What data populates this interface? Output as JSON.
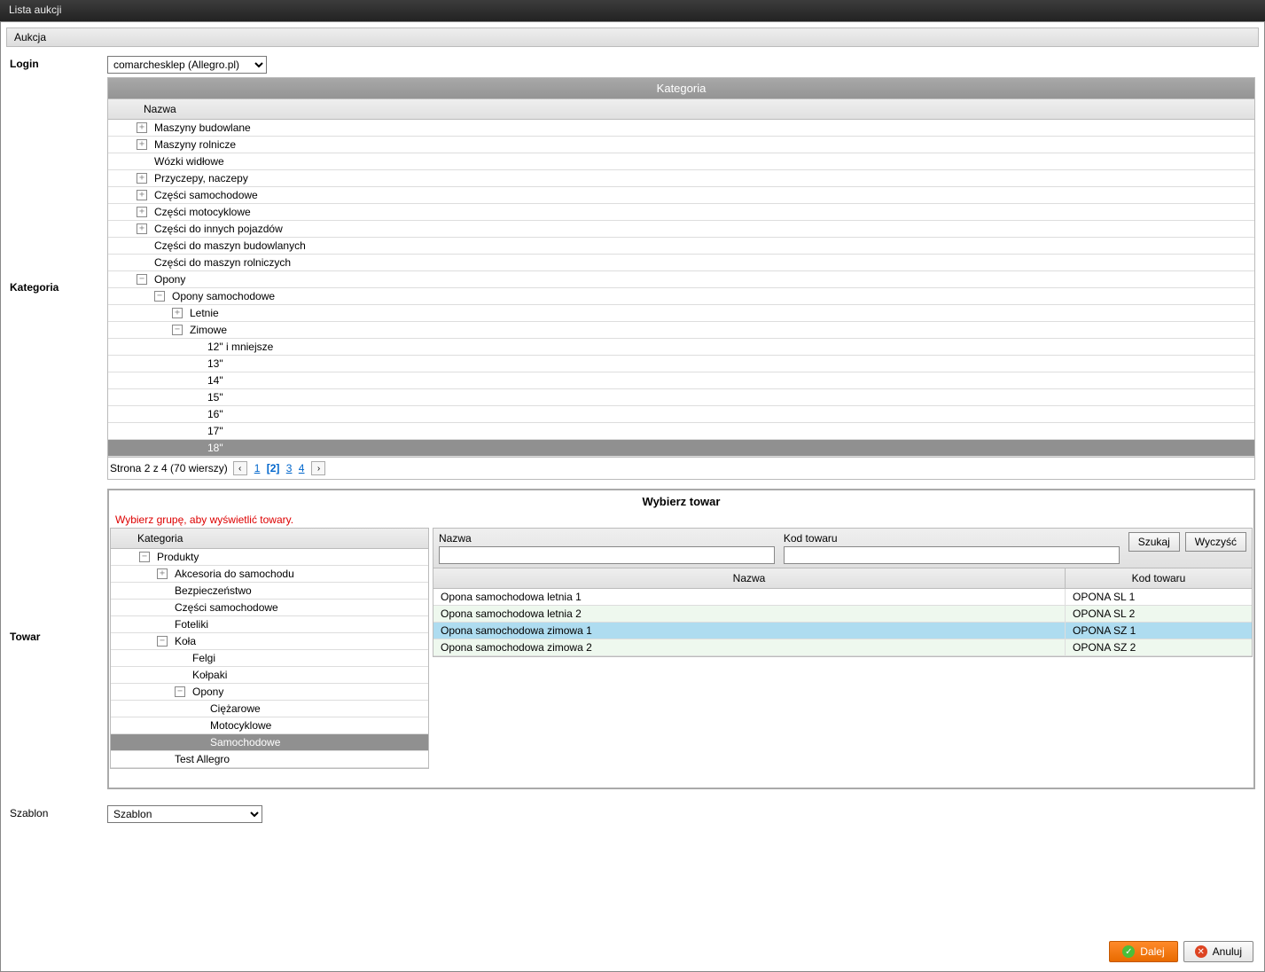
{
  "window_title": "Lista aukcji",
  "toolbar_label": "Aukcja",
  "login": {
    "label": "Login",
    "selected": "comarchesklep (Allegro.pl)"
  },
  "category": {
    "label": "Kategoria",
    "panel_title": "Kategoria",
    "name_header": "Nazwa",
    "tree": [
      {
        "d": 0,
        "exp": "+",
        "t": "Maszyny budowlane"
      },
      {
        "d": 0,
        "exp": "+",
        "t": "Maszyny rolnicze"
      },
      {
        "d": 0,
        "exp": "",
        "t": "Wózki widłowe"
      },
      {
        "d": 0,
        "exp": "+",
        "t": "Przyczepy, naczepy"
      },
      {
        "d": 0,
        "exp": "+",
        "t": "Części samochodowe"
      },
      {
        "d": 0,
        "exp": "+",
        "t": "Części motocyklowe"
      },
      {
        "d": 0,
        "exp": "+",
        "t": "Części do innych pojazdów"
      },
      {
        "d": 0,
        "exp": "",
        "t": "Części do maszyn budowlanych"
      },
      {
        "d": 0,
        "exp": "",
        "t": "Części do maszyn rolniczych"
      },
      {
        "d": 0,
        "exp": "-",
        "t": "Opony"
      },
      {
        "d": 1,
        "exp": "-",
        "t": "Opony samochodowe"
      },
      {
        "d": 2,
        "exp": "+",
        "t": "Letnie"
      },
      {
        "d": 2,
        "exp": "-",
        "t": "Zimowe"
      },
      {
        "d": 3,
        "exp": "",
        "t": "12\" i mniejsze"
      },
      {
        "d": 3,
        "exp": "",
        "t": "13\""
      },
      {
        "d": 3,
        "exp": "",
        "t": "14\""
      },
      {
        "d": 3,
        "exp": "",
        "t": "15\""
      },
      {
        "d": 3,
        "exp": "",
        "t": "16\""
      },
      {
        "d": 3,
        "exp": "",
        "t": "17\""
      },
      {
        "d": 3,
        "exp": "",
        "t": "18\"",
        "sel": true
      }
    ],
    "paging": {
      "summary": "Strona 2 z 4 (70 wierszy)",
      "pages": [
        "1",
        "2",
        "3",
        "4"
      ],
      "current": "2"
    }
  },
  "product": {
    "label": "Towar",
    "section_title": "Wybierz towar",
    "warning": "Wybierz grupę, aby wyświetlić towary.",
    "left_header": "Kategoria",
    "tree": [
      {
        "d": 0,
        "exp": "-",
        "t": "Produkty"
      },
      {
        "d": 1,
        "exp": "+",
        "t": "Akcesoria do samochodu"
      },
      {
        "d": 1,
        "exp": "",
        "t": "Bezpieczeństwo"
      },
      {
        "d": 1,
        "exp": "",
        "t": "Części samochodowe"
      },
      {
        "d": 1,
        "exp": "",
        "t": "Foteliki"
      },
      {
        "d": 1,
        "exp": "-",
        "t": "Koła"
      },
      {
        "d": 2,
        "exp": "",
        "t": "Felgi"
      },
      {
        "d": 2,
        "exp": "",
        "t": "Kołpaki"
      },
      {
        "d": 2,
        "exp": "-",
        "t": "Opony"
      },
      {
        "d": 3,
        "exp": "",
        "t": "Ciężarowe"
      },
      {
        "d": 3,
        "exp": "",
        "t": "Motocyklowe"
      },
      {
        "d": 3,
        "exp": "",
        "t": "Samochodowe",
        "sel": true
      },
      {
        "d": 1,
        "exp": "",
        "t": "Test Allegro"
      }
    ],
    "search": {
      "name_label": "Nazwa",
      "code_label": "Kod towaru",
      "search_btn": "Szukaj",
      "clear_btn": "Wyczyść"
    },
    "results_headers": {
      "name": "Nazwa",
      "code": "Kod towaru"
    },
    "results": [
      {
        "name": "Opona samochodowa letnia 1",
        "code": "OPONA SL 1",
        "cls": ""
      },
      {
        "name": "Opona samochodowa letnia 2",
        "code": "OPONA SL 2",
        "cls": "alt"
      },
      {
        "name": "Opona samochodowa zimowa 1",
        "code": "OPONA SZ 1",
        "cls": "sel"
      },
      {
        "name": "Opona samochodowa zimowa 2",
        "code": "OPONA SZ 2",
        "cls": "alt"
      }
    ]
  },
  "template": {
    "label": "Szablon",
    "selected": "Szablon"
  },
  "buttons": {
    "next": "Dalej",
    "cancel": "Anuluj"
  }
}
